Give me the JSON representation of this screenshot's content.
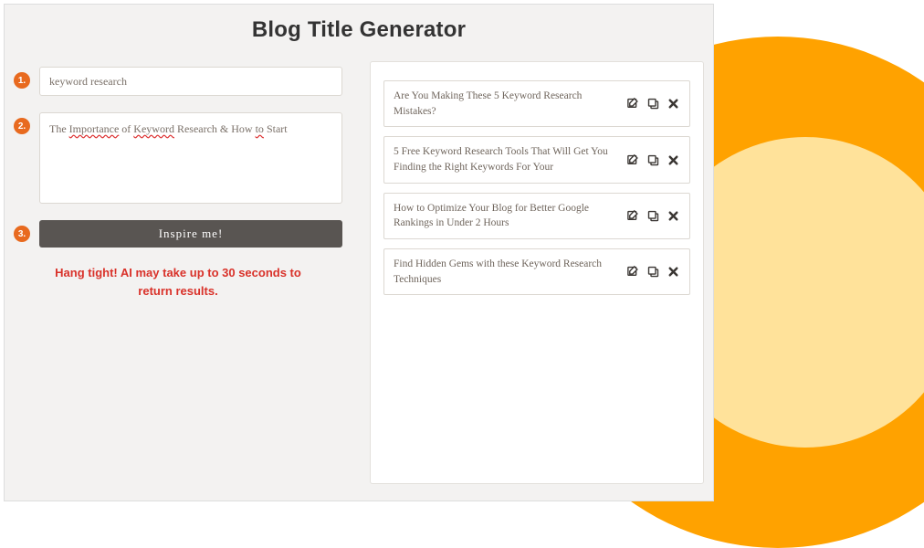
{
  "page": {
    "title": "Blog Title Generator"
  },
  "steps": {
    "one": "1.",
    "two": "2.",
    "three": "3."
  },
  "inputs": {
    "keyword_value": "keyword research",
    "sample_prefix": "The ",
    "sample_w1": "Importance",
    "sample_mid1": " of ",
    "sample_w2": "Keyword",
    "sample_mid2": " Research & How ",
    "sample_w3": "to",
    "sample_suffix": " Start"
  },
  "actions": {
    "inspire_label": "Inspire me!"
  },
  "status": {
    "loading": "Hang tight! AI may take up to 30 seconds to return results."
  },
  "results": [
    {
      "text": "Are You Making These 5 Keyword Research Mistakes?"
    },
    {
      "text": "5 Free Keyword Research Tools That Will Get You Finding the Right Keywords For Your"
    },
    {
      "text": "How to Optimize Your Blog for Better Google Rankings in Under 2 Hours"
    },
    {
      "text": "Find Hidden Gems with these Keyword Research Techniques"
    }
  ],
  "colors": {
    "accent": "#e86a1f",
    "button": "#595552",
    "status": "#d9322a",
    "decor_outer": "#ffa200",
    "decor_inner": "#ffe29a"
  }
}
